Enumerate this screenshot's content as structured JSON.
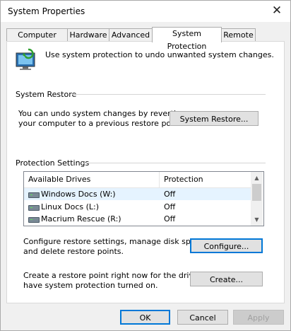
{
  "window": {
    "title": "System Properties",
    "close_glyph": "✕"
  },
  "tabs": [
    {
      "label": "Computer Name"
    },
    {
      "label": "Hardware"
    },
    {
      "label": "Advanced"
    },
    {
      "label": "System Protection"
    },
    {
      "label": "Remote"
    }
  ],
  "active_tab": "System Protection",
  "intro": {
    "text": "Use system protection to undo unwanted system changes.",
    "icon": "system-protection-icon"
  },
  "system_restore": {
    "heading": "System Restore",
    "desc_line1": "You can undo system changes by reverting",
    "desc_line2": "your computer to a previous restore point.",
    "button_label": "System Restore...",
    "button_accel": "S"
  },
  "protection_settings": {
    "heading": "Protection Settings",
    "columns": [
      "Available Drives",
      "Protection"
    ],
    "drives": [
      {
        "name": "Windows Docs (W:)",
        "protection": "Off",
        "selected": true
      },
      {
        "name": "Linux Docs (L:)",
        "protection": "Off",
        "selected": false
      },
      {
        "name": "Macrium Rescue (R:)",
        "protection": "Off",
        "selected": false
      }
    ],
    "configure": {
      "desc_line1": "Configure restore settings, manage disk space,",
      "desc_line2": "and delete restore points.",
      "button_label": "Configure..."
    },
    "create": {
      "desc_line1": "Create a restore point right now for the drives that",
      "desc_line2": "have system protection turned on.",
      "button_label": "Create..."
    }
  },
  "footer": {
    "ok": "OK",
    "cancel": "Cancel",
    "apply": "Apply"
  },
  "colors": {
    "focus": "#0078d7",
    "selected_row": "#e5f3ff"
  }
}
